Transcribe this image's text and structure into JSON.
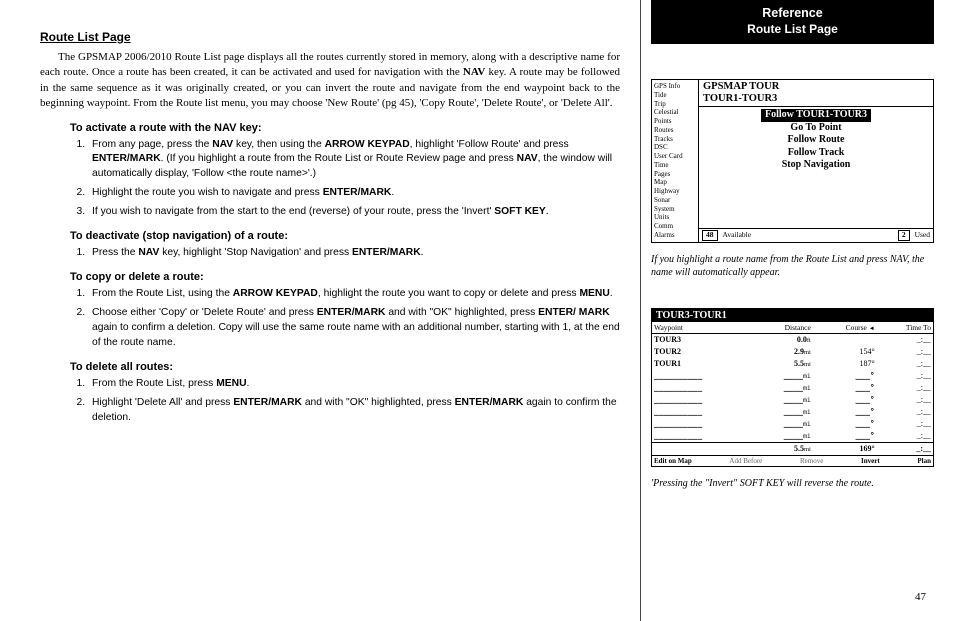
{
  "main": {
    "title": "Route List Page",
    "intro_html": "The GPSMAP 2006/2010 Route List page displays all the routes currently stored in memory, along with a descriptive name for each route. Once a route has been created, it can be activated and used for navigation with the <b>NAV</b> key. A route may be followed in the same sequence as it was originally created, or you can invert the route and navigate from the end waypoint back to the beginning waypoint. From the Route list menu, you may choose 'New Route' (pg 45), 'Copy Route', 'Delete Route', or 'Delete All'.",
    "sec1": {
      "title": "To activate a route with the NAV key:",
      "steps": [
        "From any page, press the <b>NAV</b> key, then using the <b>ARROW KEYPAD</b>, highlight 'Follow Route' and press <b>ENTER/MARK</b>. (If you highlight a route from the Route List or Route Review page and press <b>NAV</b>, the window will automatically display, 'Follow &lt;the route name&gt;'.)",
        "Highlight the route you wish to navigate and press <b>ENTER/MARK</b>.",
        "If you wish to navigate from the start to the end (reverse) of your route, press the 'Invert' <b>SOFT KEY</b>."
      ]
    },
    "sec2": {
      "title": "To deactivate (stop navigation) of a route:",
      "steps": [
        "Press the <b>NAV</b> key, highlight 'Stop Navigation' and press <b>ENTER/MARK</b>."
      ]
    },
    "sec3": {
      "title": "To copy or delete a route:",
      "steps": [
        "From the Route List, using the <b>ARROW KEYPAD</b>, highlight the route you want to copy or delete and press <b>MENU</b>.",
        "Choose either 'Copy' or 'Delete Route' and press <b>ENTER/MARK</b> and with \"OK\" highlighted, press <b>ENTER/ MARK</b> again to confirm a deletion. Copy will use the same route name with an additional number, starting with 1, at the end of the route name."
      ]
    },
    "sec4": {
      "title": "To delete all routes:",
      "steps": [
        "From the Route List, press <b>MENU</b>.",
        "Highlight 'Delete All' and press <b>ENTER/MARK</b> and with \"OK\" highlighted, press <b>ENTER/MARK</b> again to confirm the deletion."
      ]
    }
  },
  "sidebar": {
    "ref_title": "Reference",
    "ref_sub": "Route List Page",
    "fig1": {
      "left_items": [
        "GPS Info",
        "Tide",
        "Trip",
        "Celestial",
        "Points",
        "Routes",
        "Tracks",
        "DSC",
        "User Card",
        "Time",
        "Pages",
        "Map",
        "Highway",
        "Sonar",
        "System",
        "Units",
        "Comm",
        "Alarms"
      ],
      "title_line1": "GPSMAP TOUR",
      "title_line2": "TOUR1-TOUR3",
      "menu": [
        {
          "label": "Follow TOUR1-TOUR3",
          "highlight": true
        },
        {
          "label": "Go To Point",
          "highlight": false
        },
        {
          "label": "Follow Route",
          "highlight": false
        },
        {
          "label": "Follow Track",
          "highlight": false
        },
        {
          "label": "Stop Navigation",
          "highlight": false
        }
      ],
      "foot_avail_num": "48",
      "foot_avail_lbl": "Available",
      "foot_used_num": "2",
      "foot_used_lbl": "Used",
      "caption": "If you highlight a route name from the Route List and press NAV, the name will automatically appear."
    },
    "fig2": {
      "title": "TOUR3-TOUR1",
      "headers": [
        "Waypoint",
        "Distance",
        "Course",
        "Time To"
      ],
      "rows": [
        {
          "wp": "TOUR3",
          "dist": "0.0",
          "unit": "ft",
          "course": "",
          "time": "_:__"
        },
        {
          "wp": "TOUR2",
          "dist": "2.9",
          "unit": "mi",
          "course": "154°",
          "time": "_:__"
        },
        {
          "wp": "TOUR1",
          "dist": "5.5",
          "unit": "mi",
          "course": "187°",
          "time": "_:__"
        }
      ],
      "blank_rows": 6,
      "total": {
        "dist": "5.5",
        "unit": "mi",
        "course": "169°",
        "time": "_:__"
      },
      "softkeys": [
        "Edit on Map",
        "Add Before",
        "Remove",
        "Invert",
        "Plan"
      ],
      "caption": "'Pressing the \"Invert\" SOFT KEY will reverse the route."
    },
    "page_number": "47"
  }
}
